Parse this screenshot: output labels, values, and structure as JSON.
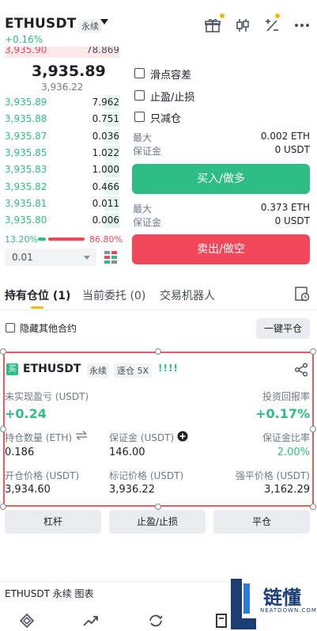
{
  "header": {
    "symbol": "ETHUSDT",
    "contract_type": "永续",
    "change_pct": "+0.16%",
    "icons": [
      "gift-icon",
      "candlestick-icon",
      "calculator-icon",
      "more-icon"
    ],
    "accent_color": "#f0b90b"
  },
  "orderbook": {
    "partial_ask": {
      "price": "3,935.90",
      "qty": "78.869"
    },
    "last_price": "3,935.89",
    "mark_price": "3,936.22",
    "bids": [
      {
        "price": "3,935.89",
        "qty": "7.962",
        "depth": 0.13
      },
      {
        "price": "3,935.88",
        "qty": "0.751",
        "depth": 0.13
      },
      {
        "price": "3,935.87",
        "qty": "0.036",
        "depth": 0.13
      },
      {
        "price": "3,935.85",
        "qty": "1.022",
        "depth": 0.13
      },
      {
        "price": "3,935.83",
        "qty": "1.000",
        "depth": 0.13
      },
      {
        "price": "3,935.82",
        "qty": "0.466",
        "depth": 0.13
      },
      {
        "price": "3,935.81",
        "qty": "0.011",
        "depth": 0.13
      },
      {
        "price": "3,935.80",
        "qty": "0.006",
        "depth": 0.13
      }
    ],
    "bid_ratio": "13.20%",
    "ask_ratio": "86.80%",
    "precision": "0.01"
  },
  "order_form": {
    "slippage": "滑点容差",
    "tp_sl": "止盈/止损",
    "reduce_only": "只减仓",
    "buy": {
      "max_label": "最大",
      "max_value": "0.002 ETH",
      "margin_label": "保证金",
      "margin_value": "0 USDT",
      "button": "买入/做多"
    },
    "sell": {
      "max_label": "最大",
      "max_value": "0.373 ETH",
      "margin_label": "保证金",
      "margin_value": "0 USDT",
      "button": "卖出/做空"
    }
  },
  "tabs": [
    {
      "label": "持有仓位 (1)"
    },
    {
      "label": "当前委托 (0)"
    },
    {
      "label": "交易机器人"
    }
  ],
  "hide_other": "隐藏其他合约",
  "close_all": "一键平仓",
  "position": {
    "side_badge": "买",
    "symbol": "ETHUSDT",
    "type": "永续",
    "leverage": "逐仓 5X",
    "strength_bars": "!!!!",
    "pnl_label": "未实现盈亏 (USDT)",
    "pnl_value": "+0.24",
    "roe_label": "投资回报率",
    "roe_value": "+0.17%",
    "qty_label": "持仓数量 (ETH)",
    "qty_value": "0.186",
    "margin_label": "保证金 (USDT)",
    "margin_value": "146.00",
    "margin_ratio_label": "保证金比率",
    "margin_ratio_value": "2.00%",
    "entry_label": "开仓价格 (USDT)",
    "entry_value": "3,934.60",
    "mark_label": "标记价格 (USDT)",
    "mark_value": "3,936.22",
    "liq_label": "强平价格 (USDT)",
    "liq_value": "3,162.29"
  },
  "actions": {
    "leverage": "杠杆",
    "tpsl": "止盈/止损",
    "close": "平仓"
  },
  "footer": {
    "text": "ETHUSDT 永续  图表"
  },
  "watermark": {
    "title": "链懂",
    "sub": "NEATDOWN.COM"
  },
  "colors": {
    "green": "#2ebd85",
    "red": "#f0475a",
    "yellow": "#f0b90b"
  }
}
